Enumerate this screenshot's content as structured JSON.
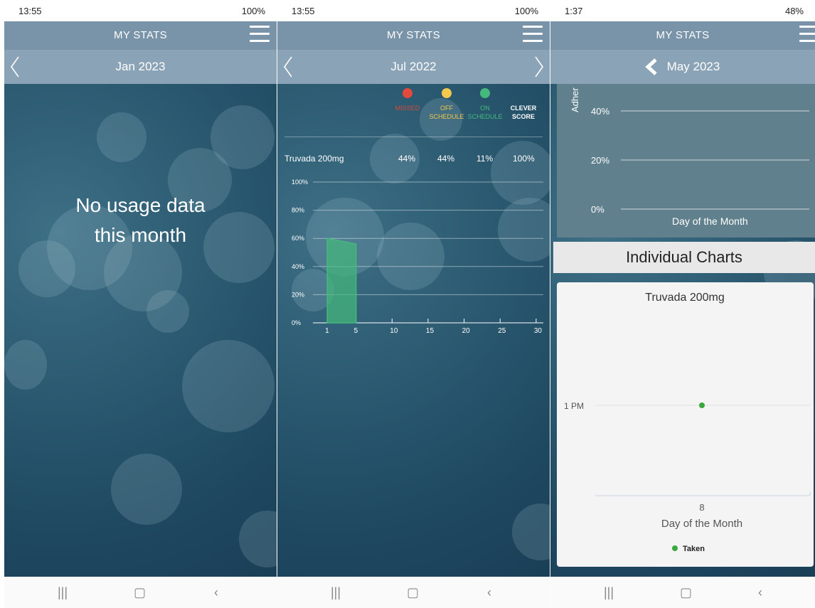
{
  "panels": [
    {
      "status": {
        "time": "13:55",
        "right": "100%"
      },
      "header": {
        "title": "MY STATS"
      },
      "month": "Jan 2023",
      "message": "No usage data this month"
    },
    {
      "status": {
        "time": "13:55",
        "right": "100%"
      },
      "header": {
        "title": "MY STATS"
      },
      "month": "Jul 2022",
      "legend": [
        {
          "label1": "MISSED",
          "label2": "",
          "color": "#e34a3b",
          "text_color": "#d44a3b"
        },
        {
          "label1": "OFF",
          "label2": "SCHEDULE",
          "color": "#f2c94c",
          "text_color": "#f2c94c"
        },
        {
          "label1": "ON",
          "label2": "SCHEDULE",
          "color": "#45b97c",
          "text_color": "#45b97c"
        },
        {
          "label1": "CLEVER",
          "label2": "SCORE",
          "color": "",
          "text_color": "#ffffff"
        }
      ],
      "table": {
        "drug": "Truvada 200mg",
        "missed": "44%",
        "off_schedule": "44%",
        "on_schedule": "11%",
        "score": "100%"
      }
    },
    {
      "status": {
        "time": "1:37",
        "right": "48%"
      },
      "header": {
        "title": "MY STATS"
      },
      "month": "May 2023",
      "adherence_axis_label": "Adher",
      "individual_charts": "Individual Charts",
      "card_title": "Truvada 200mg",
      "legend_taken": "Taken"
    }
  ],
  "chart_data": [
    {
      "type": "area",
      "x": [
        1,
        5
      ],
      "y": [
        60,
        56
      ],
      "xticks": [
        "1",
        "5",
        "10",
        "15",
        "20",
        "25",
        "30"
      ],
      "yticks": [
        "0%",
        "20%",
        "40%",
        "60%",
        "80%",
        "100%"
      ],
      "ylim": [
        0,
        100
      ],
      "xlim": [
        0,
        31
      ],
      "color": "#45b97c",
      "grid": true
    },
    {
      "type": "line",
      "yticks": [
        "0%",
        "20%",
        "40%"
      ],
      "xlabel": "Day of the Month",
      "ylabel": "Adher",
      "grid": true
    },
    {
      "type": "scatter",
      "title": "Truvada 200mg",
      "x": [
        8
      ],
      "y": [
        "1 PM"
      ],
      "xticks": [
        "8"
      ],
      "yticks": [
        "1 PM"
      ],
      "xlabel": "Day of the Month",
      "series": [
        {
          "name": "Taken",
          "color": "#3aa83a"
        }
      ]
    }
  ]
}
